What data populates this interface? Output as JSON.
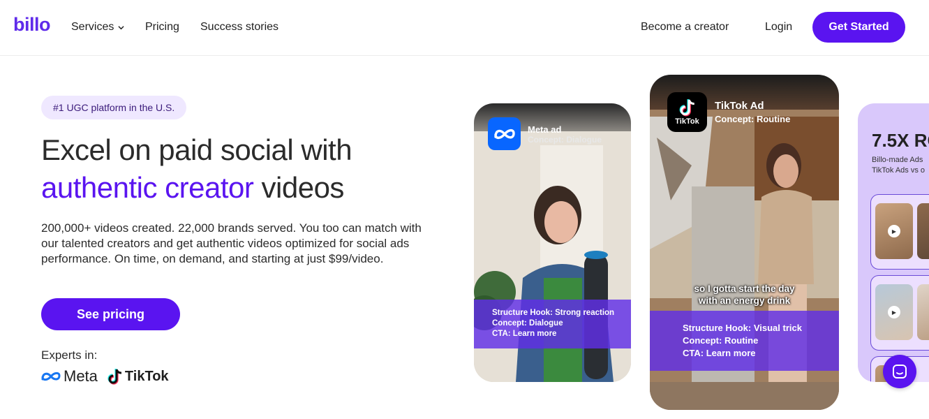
{
  "header": {
    "logo": "billo",
    "nav": {
      "services": "Services",
      "pricing": "Pricing",
      "success_stories": "Success stories",
      "become_creator": "Become a creator",
      "login": "Login"
    },
    "cta": "Get Started"
  },
  "hero": {
    "badge": "#1 UGC platform in the U.S.",
    "headline_line1": "Excel on paid social with",
    "headline_accent": "authentic creator",
    "headline_end": " videos",
    "subtext": "200,000+ videos created. 22,000 brands served. You too can match with our talented creators and get authentic videos optimized for social ads performance. On time, on demand, and starting at just $99/video.",
    "cta": "See pricing",
    "experts_label": "Experts in:",
    "experts": {
      "meta": "Meta",
      "tiktok": "TikTok"
    }
  },
  "cards": {
    "meta": {
      "title": "Meta ad",
      "concept": "Concept: Dialogue",
      "info": [
        "Structure Hook: Strong reaction",
        "Concept: Dialogue",
        "CTA: Learn more"
      ]
    },
    "tiktok": {
      "icon_label": "TikTok",
      "title": "TikTok Ad",
      "concept": "Concept: Routine",
      "caption_line1": "so I gotta start the day",
      "caption_line2": "with an energy drink",
      "info": [
        "Structure Hook: Visual trick",
        "Concept: Routine",
        "CTA: Learn more"
      ]
    },
    "roi": {
      "title": "7.5X RO",
      "desc_line1": "Billo-made Ads",
      "desc_line2": "TikTok Ads vs o"
    }
  },
  "colors": {
    "brand": "#5a14f0",
    "badge_bg": "#efe8ff",
    "card_overlay": "#602ee6",
    "roi_bg": "#d9c8fb"
  }
}
